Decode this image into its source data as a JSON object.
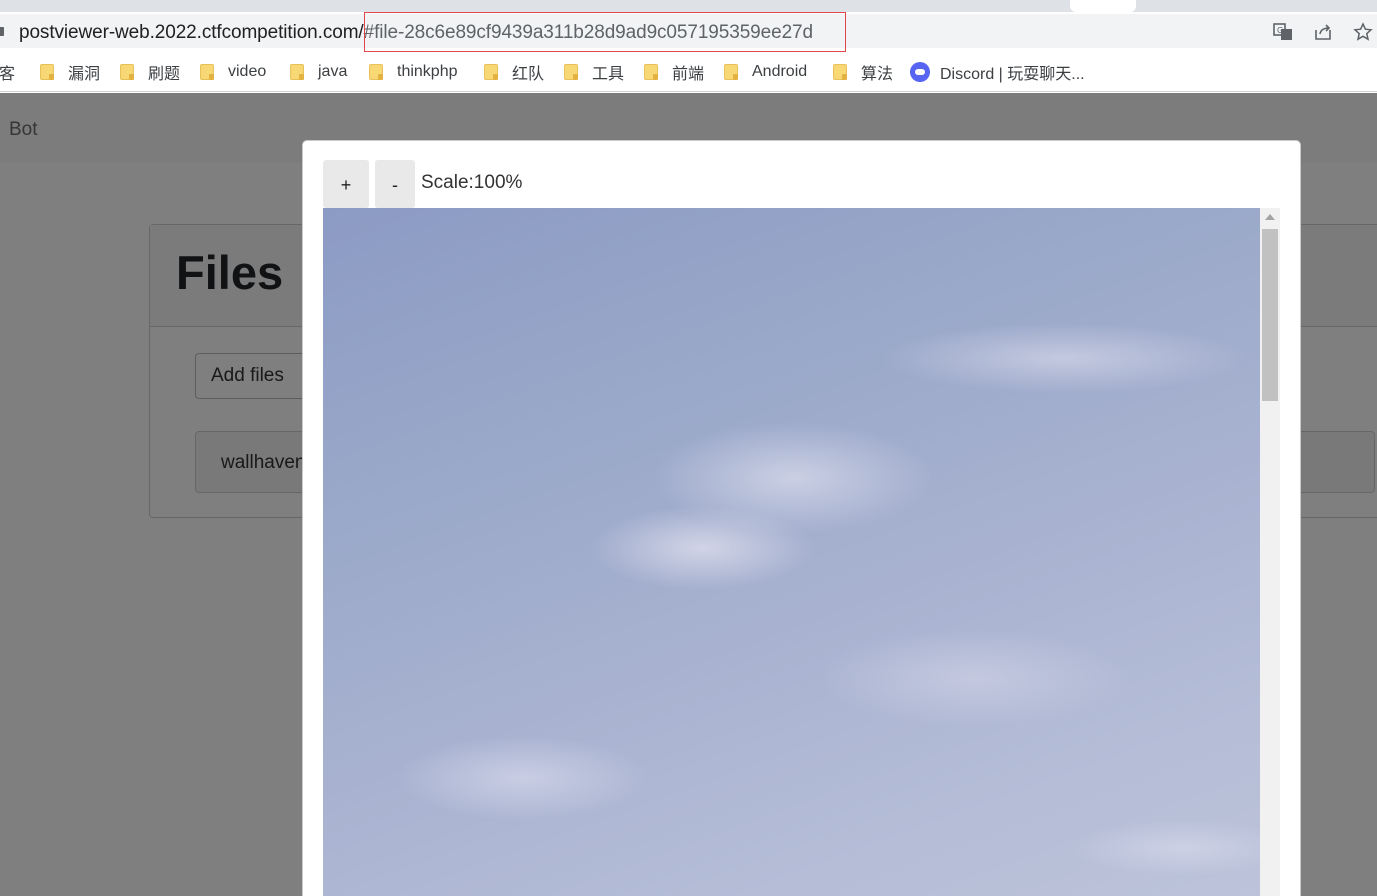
{
  "browser": {
    "url_host": "postviewer-web.2022.ctfcompetition.com/",
    "url_hash": "#file-28c6e89cf9439a311b28d9ad9c057195359ee27d",
    "icons": [
      "translate-icon",
      "share-icon",
      "bookmark-star-icon"
    ]
  },
  "bookmarks": [
    {
      "label": "客",
      "type": "partial"
    },
    {
      "label": "漏洞",
      "type": "folder"
    },
    {
      "label": "刷题",
      "type": "folder"
    },
    {
      "label": "video",
      "type": "folder"
    },
    {
      "label": "java",
      "type": "folder"
    },
    {
      "label": "thinkphp",
      "type": "folder"
    },
    {
      "label": "红队",
      "type": "folder"
    },
    {
      "label": "工具",
      "type": "folder"
    },
    {
      "label": "前端",
      "type": "folder"
    },
    {
      "label": "Android",
      "type": "folder"
    },
    {
      "label": "算法",
      "type": "folder"
    },
    {
      "label": "Discord | 玩耍聊天...",
      "type": "site"
    }
  ],
  "page": {
    "brand": "Bot",
    "files_title": "Files",
    "add_files_label": "Add files",
    "file_item_label": "wallhaven"
  },
  "viewer": {
    "zoom_in_label": "+",
    "zoom_out_label": "-",
    "scale_label": "Scale:100%"
  },
  "colors": {
    "highlight": "#e0474c",
    "discord": "#5865f2",
    "folder": "#f8d775"
  }
}
